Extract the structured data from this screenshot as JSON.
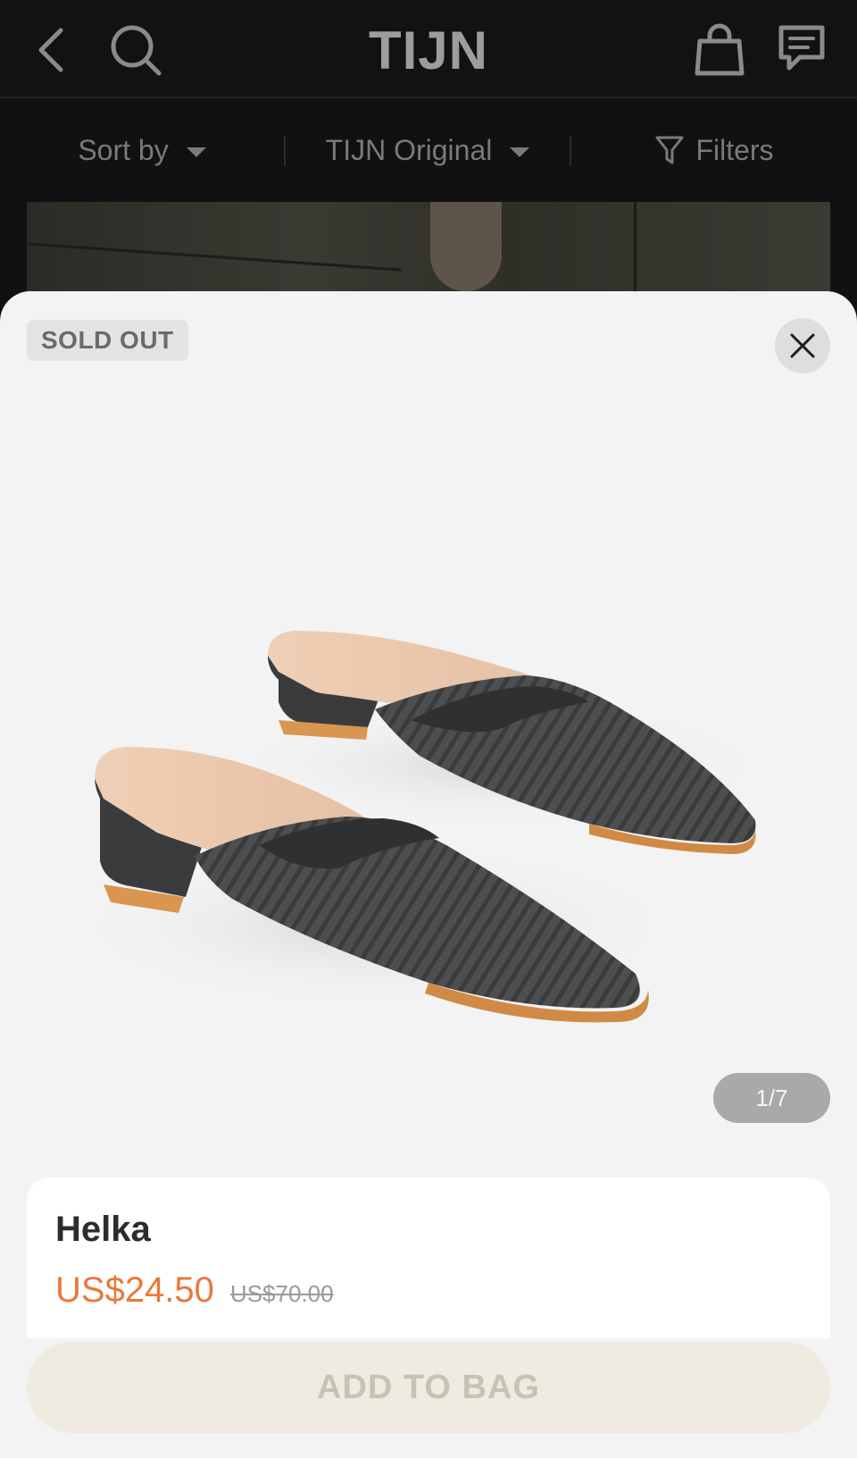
{
  "header": {
    "brand": "TIJN",
    "icons": [
      "back-icon",
      "search-icon",
      "shopping-bag-icon",
      "chat-icon"
    ]
  },
  "filters": {
    "sort_label": "Sort by",
    "collection_label": "TIJN Original",
    "filters_label": "Filters"
  },
  "product": {
    "status_badge": "SOLD OUT",
    "image_counter": "1/7",
    "name": "Helka",
    "sale_price": "US$24.50",
    "original_price": "US$70.00"
  },
  "actions": {
    "add_to_bag_label": "ADD TO BAG"
  },
  "colors": {
    "accent_price": "#e8793c",
    "header_bg": "#121212",
    "sheet_bg": "#f3f3f3",
    "button_disabled_bg": "#efebe1"
  }
}
